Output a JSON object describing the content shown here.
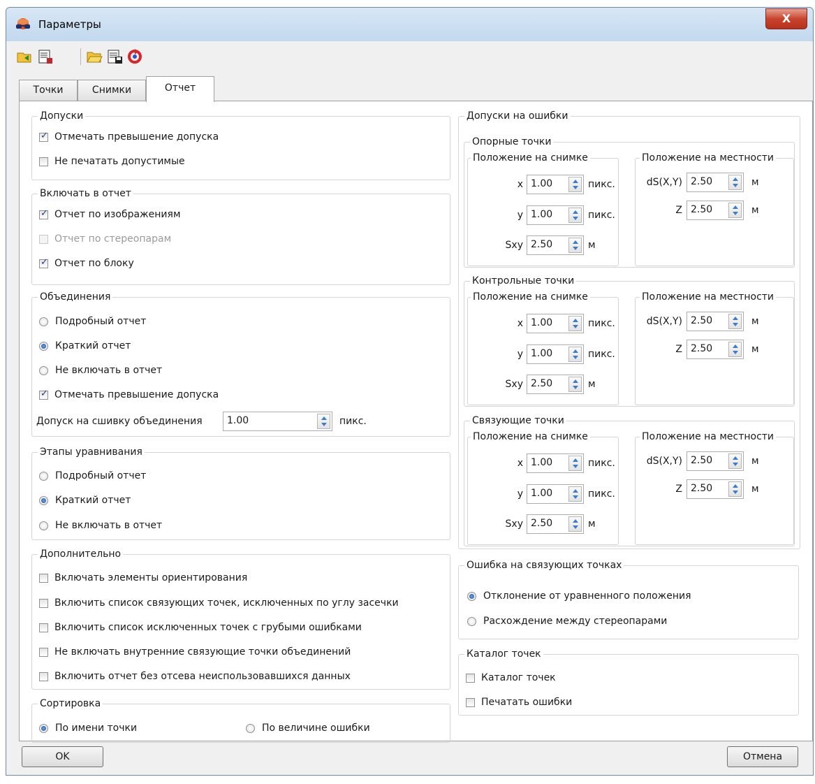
{
  "window": {
    "title": "Параметры",
    "close_label": "X"
  },
  "toolbar": {
    "icons": [
      "open-settings-icon",
      "save-settings-icon",
      "open-folder-icon",
      "save-as-icon",
      "reset-icon"
    ]
  },
  "tabs": [
    "Точки",
    "Снимки",
    "Отчет"
  ],
  "active_tab": "Отчет",
  "left": {
    "tolerances": {
      "title": "Допуски",
      "items": [
        {
          "label": "Отмечать превышение допуска",
          "checked": true
        },
        {
          "label": "Не печатать допустимые",
          "checked": false
        }
      ]
    },
    "include": {
      "title": "Включать в отчет",
      "items": [
        {
          "label": "Отчет по изображениям",
          "checked": true
        },
        {
          "label": "Отчет по стереопарам",
          "checked": false,
          "disabled": true
        },
        {
          "label": "Отчет по блоку",
          "checked": true
        }
      ]
    },
    "merges": {
      "title": "Объединения",
      "radios": [
        "Подробный отчет",
        "Краткий отчет",
        "Не включать в отчет"
      ],
      "selected": 1,
      "check_label": "Отмечать превышение допуска",
      "check_on": true,
      "stitch_label": "Допуск на сшивку объединения",
      "stitch_value": "1.00",
      "stitch_unit": "пикс."
    },
    "stages": {
      "title": "Этапы уравнивания",
      "radios": [
        "Подробный отчет",
        "Краткий отчет",
        "Не включать в отчет"
      ],
      "selected": 1
    },
    "extra": {
      "title": "Дополнительно",
      "items": [
        "Включать элементы ориентирования",
        "Включить список связующих точек, исключенных по углу засечки",
        "Включить список исключенных точек с грубыми ошибками",
        "Не включать внутренние связующие точки объединений",
        "Включить отчет без отсева неиспользовавшихся данных"
      ]
    },
    "sort": {
      "title": "Сортировка",
      "radios": [
        "По имени точки",
        "По величине ошибки"
      ],
      "selected": 0
    }
  },
  "right": {
    "errors_title": "Допуски на ошибки",
    "sections": [
      {
        "title": "Опорные точки"
      },
      {
        "title": "Контрольные точки"
      },
      {
        "title": "Связующие точки"
      }
    ],
    "image_pos_title": "Положение на снимке",
    "ground_pos_title": "Положение на местности",
    "image_fields": [
      {
        "label": "x",
        "value": "1.00",
        "unit": "пикс."
      },
      {
        "label": "y",
        "value": "1.00",
        "unit": "пикс."
      },
      {
        "label": "Sxy",
        "value": "2.50",
        "unit": "м"
      }
    ],
    "ground_fields": [
      {
        "label": "dS(X,Y)",
        "value": "2.50",
        "unit": "м"
      },
      {
        "label": "Z",
        "value": "2.50",
        "unit": "м"
      }
    ],
    "tie_error": {
      "title": "Ошибка на связующих точках",
      "radios": [
        "Отклонение от уравненного положения",
        "Расхождение между стереопарами"
      ],
      "selected": 0
    },
    "catalog": {
      "title": "Каталог точек",
      "items": [
        "Каталог точек",
        "Печатать ошибки"
      ]
    }
  },
  "footer": {
    "ok_label": "OK",
    "cancel_label": "Отмена"
  }
}
